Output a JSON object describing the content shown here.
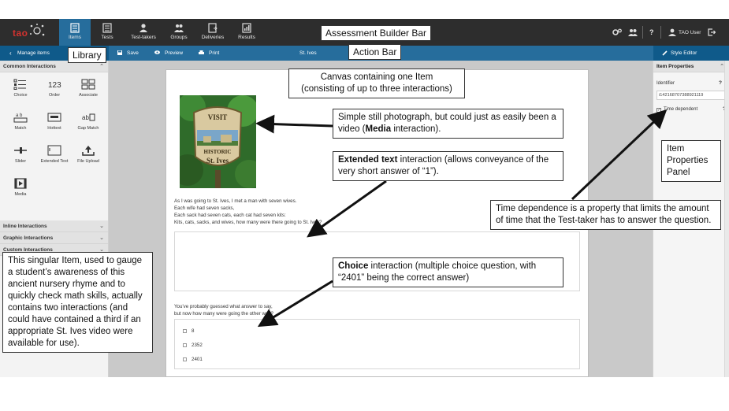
{
  "app": {
    "logo_text": "tao",
    "nav": [
      {
        "label": "Items",
        "icon": "items-icon",
        "active": true
      },
      {
        "label": "Tests",
        "icon": "tests-icon"
      },
      {
        "label": "Test-takers",
        "icon": "test-takers-icon"
      },
      {
        "label": "Groups",
        "icon": "groups-icon"
      },
      {
        "label": "Deliveries",
        "icon": "deliveries-icon"
      },
      {
        "label": "Results",
        "icon": "results-icon"
      }
    ],
    "right": {
      "settings_icon": "gears-icon",
      "users_icon": "users-icon",
      "help": "?",
      "user": "TAO User",
      "logout_icon": "logout-icon"
    }
  },
  "action_bar": {
    "manage_items": "Manage items",
    "save": "Save",
    "preview": "Preview",
    "print": "Print",
    "title": "St. Ives",
    "style_editor": "Style Editor"
  },
  "library": {
    "sections": {
      "common": "Common Interactions",
      "inline": "Inline Interactions",
      "graphic": "Graphic Interactions",
      "custom": "Custom Interactions"
    },
    "common_items": [
      "Choice",
      "Order",
      "Associate",
      "Match",
      "Hottext",
      "Gap Match",
      "Slider",
      "Extended Text",
      "File Upload",
      "Media"
    ]
  },
  "canvas": {
    "stem_lines": [
      "As I was going to St. Ives, I met a man with seven wives.",
      "Each wife had seven sacks,",
      "Each sack had seven cats, each cat had seven kits:",
      "Kits, cats, sacks, and wives, how many were there going to St. Ives?"
    ],
    "photo_text": {
      "top": "VISIT",
      "mid": "HISTORIC",
      "bottom": "St. Ives"
    },
    "prompt2_lines": [
      "You've probably guessed what answer to say,",
      "but now how many were going the other way?"
    ],
    "choices": [
      "8",
      "2352",
      "2401"
    ]
  },
  "properties": {
    "header": "Item Properties",
    "identifier_label": "Identifier",
    "identifier_value": "i142168707388921119",
    "time_dependent_label": "Time dependent",
    "help": "?"
  },
  "annotations": {
    "assessment_bar": "Assessment Builder Bar",
    "action_bar": "Action Bar",
    "library": "Library",
    "canvas": [
      "Canvas containing one Item",
      "(consisting of up to three interactions)"
    ],
    "media_pre": "Simple still photograph, but could just as easily been a video (",
    "media_bold": "Media",
    "media_post": " interaction).",
    "ext_bold": "Extended text",
    "ext_post": " interaction (allows conveyance of the very short answer of “1”).",
    "props_panel": [
      "Item",
      "Properties",
      "Panel"
    ],
    "time_dep": "Time dependence is a property that limits the amount of time that the Test-taker has to answer the question.",
    "choice_bold": "Choice",
    "choice_post": " interaction (multiple choice question, with “2401” being the correct answer)",
    "singular": "This singular Item, used to gauge a student’s awareness of this ancient nursery rhyme and to quickly check math skills, actually contains two interactions (and could have contained a third if an appropriate St. Ives video were available for use)."
  },
  "colors": {
    "appbar": "#2d2d2d",
    "actionbar": "#266d9c",
    "accent_dark": "#0f5a8a",
    "logo_red": "#d3322f"
  }
}
